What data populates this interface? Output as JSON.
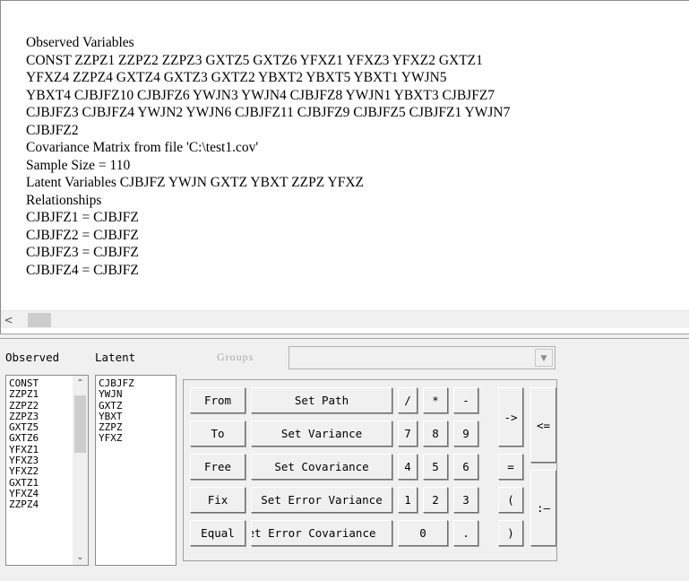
{
  "editor": {
    "lines": [
      "Observed Variables",
      "CONST ZZPZ1 ZZPZ2 ZZPZ3 GXTZ5 GXTZ6 YFXZ1 YFXZ3 YFXZ2 GXTZ1",
      "YFXZ4 ZZPZ4 GXTZ4 GXTZ3 GXTZ2 YBXT2 YBXT5 YBXT1 YWJN5",
      "YBXT4 CJBJFZ10 CJBJFZ6 YWJN3 YWJN4 CJBJFZ8 YWJN1 YBXT3 CJBJFZ7",
      "CJBJFZ3 CJBJFZ4 YWJN2 YWJN6 CJBJFZ11 CJBJFZ9 CJBJFZ5 CJBJFZ1 YWJN7",
      "CJBJFZ2",
      "Covariance Matrix from file 'C:\\test1.cov'",
      "Sample Size = 110",
      "Latent Variables  CJBJFZ YWJN GXTZ YBXT ZZPZ YFXZ",
      "Relationships",
      "CJBJFZ1 = CJBJFZ",
      "CJBJFZ2 = CJBJFZ",
      "CJBJFZ3 = CJBJFZ",
      "CJBJFZ4 = CJBJFZ"
    ],
    "scroll_left_icon": "chevron-left-icon"
  },
  "panel": {
    "observed_label": "Observed",
    "latent_label": "Latent",
    "groups_label": "Groups",
    "groups_value": "",
    "observed_items": [
      "CONST",
      "ZZPZ1",
      "ZZPZ2",
      "ZZPZ3",
      "GXTZ5",
      "GXTZ6",
      "YFXZ1",
      "YFXZ3",
      "YFXZ2",
      "GXTZ1",
      "YFXZ4",
      "ZZPZ4"
    ],
    "latent_items": [
      "CJBJFZ",
      "YWJN",
      "GXTZ",
      "YBXT",
      "ZZPZ",
      "YFXZ"
    ],
    "up_icon": "chevron-up-icon",
    "down_icon": "chevron-down-icon",
    "dropdown_icon": "dropdown-arrow-icon"
  },
  "buttons": {
    "from": "From",
    "to": "To",
    "free": "Free",
    "fix": "Fix",
    "equal": "Equal",
    "set_path": "Set Path",
    "set_variance": "Set Variance",
    "set_covariance": "Set Covariance",
    "set_error_variance": "Set Error Variance",
    "set_error_covariance": "Set Error Covariance",
    "slash": "/",
    "star": "*",
    "minus": "-",
    "seven": "7",
    "eight": "8",
    "nine": "9",
    "four": "4",
    "five": "5",
    "six": "6",
    "one": "1",
    "two": "2",
    "three": "3",
    "zero": "0",
    "dot": ".",
    "arrow": "->",
    "eq": "=",
    "lparen": "(",
    "rparen": ")",
    "assign": "<=",
    "colon_dash": ":—"
  }
}
